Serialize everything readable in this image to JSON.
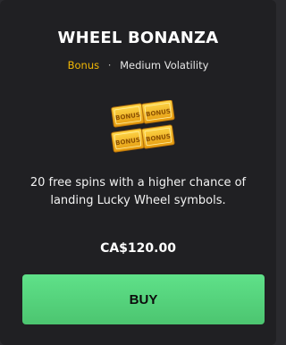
{
  "offer": {
    "title": "WHEEL BONANZA",
    "tag": "Bonus",
    "separator": "·",
    "volatility": "Medium Volatility",
    "icon": "bonus-tickets-icon",
    "ticket_label": "BONUS",
    "description": "20 free spins with a higher chance of landing Lucky Wheel symbols.",
    "price": "CA$120.00",
    "buy_label": "BUY"
  },
  "colors": {
    "card_bg": "#202023",
    "tag": "#f2b705",
    "buy_button": "#56d27b",
    "ticket_gold": "#f0b21b"
  }
}
